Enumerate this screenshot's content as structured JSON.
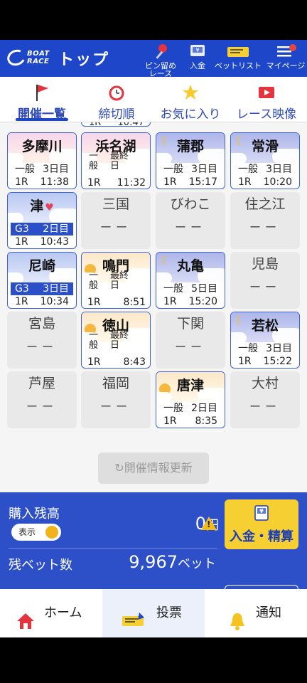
{
  "header": {
    "logo_line1": "BOAT",
    "logo_line2": "RACE",
    "title": "トップ",
    "buttons": [
      {
        "label": "ピン留め\nレース",
        "icon": "pin-icon"
      },
      {
        "label": "入金",
        "icon": "deposit-machine-icon"
      },
      {
        "label": "ベットリスト",
        "icon": "ticket-icon"
      },
      {
        "label": "マイページ",
        "icon": "menu-icon"
      }
    ]
  },
  "tabs": [
    {
      "label": "開催一覧",
      "icon": "flag-icon",
      "active": true
    },
    {
      "label": "締切順",
      "icon": "alarm-clock-icon"
    },
    {
      "label": "お気に入り",
      "icon": "star-icon"
    },
    {
      "label": "レース映像",
      "icon": "video-icon"
    }
  ],
  "venues": [
    {
      "name": "多摩川",
      "state": "open",
      "scene": "dusk",
      "grade": "一般",
      "day": "3日目",
      "race": "1R",
      "time": "11:38"
    },
    {
      "name": "浜名湖",
      "state": "open",
      "scene": "dusk",
      "grade": "一般",
      "day": "最終日",
      "race": "1R",
      "time": "11:32",
      "stacked": true
    },
    {
      "name": "蒲郡",
      "state": "open",
      "scene": "night",
      "grade": "一般",
      "day": "3日目",
      "race": "1R",
      "time": "15:17"
    },
    {
      "name": "常滑",
      "state": "open",
      "scene": "night",
      "grade": "一般",
      "day": "3日目",
      "race": "1R",
      "time": "10:20"
    },
    {
      "name": "津",
      "state": "open",
      "scene": "day",
      "grade": "G3",
      "day": "2日目",
      "race": "1R",
      "time": "10:43",
      "favorite": true
    },
    {
      "name": "三国",
      "state": "closed",
      "dash": "ーー"
    },
    {
      "name": "びわこ",
      "state": "closed",
      "dash": "ーー"
    },
    {
      "name": "住之江",
      "state": "closed",
      "dash": "ーー"
    },
    {
      "name": "尼崎",
      "state": "open",
      "scene": "day",
      "grade": "G3",
      "day": "3日目",
      "race": "1R",
      "time": "10:34"
    },
    {
      "name": "鳴門",
      "state": "open",
      "scene": "morning",
      "grade": "一般",
      "day": "最終日",
      "race": "1R",
      "time": "8:51",
      "stacked": true
    },
    {
      "name": "丸亀",
      "state": "open",
      "scene": "night",
      "grade": "一般",
      "day": "5日目",
      "race": "1R",
      "time": "15:20"
    },
    {
      "name": "児島",
      "state": "closed",
      "dash": "ーー"
    },
    {
      "name": "宮島",
      "state": "closed",
      "dash": "ーー"
    },
    {
      "name": "徳山",
      "state": "open",
      "scene": "morning",
      "grade": "一般",
      "day": "最終日",
      "race": "1R",
      "time": "8:43",
      "stacked": true
    },
    {
      "name": "下関",
      "state": "closed",
      "dash": "ーー"
    },
    {
      "name": "若松",
      "state": "open",
      "scene": "night",
      "grade": "一般",
      "day": "3日目",
      "race": "1R",
      "time": "15:22"
    },
    {
      "name": "芦屋",
      "state": "closed",
      "dash": "ーー"
    },
    {
      "name": "福岡",
      "state": "closed",
      "dash": "ーー"
    },
    {
      "name": "唐津",
      "state": "open",
      "scene": "morning",
      "grade": "一般",
      "day": "2日目",
      "race": "1R",
      "time": "8:35"
    },
    {
      "name": "大村",
      "state": "closed",
      "dash": "ーー"
    }
  ],
  "partial_row": {
    "texts": [
      "1R",
      "10:47"
    ]
  },
  "refresh_label": "開催情報更新",
  "balance_panel": {
    "purchase_balance_label": "購入残高",
    "toggle_label": "表示",
    "balance_value": "0",
    "balance_unit": "円",
    "remaining_bets_label": "残ベット数",
    "remaining_bets_value": "9,967",
    "remaining_bets_unit": "ベット",
    "deposit_button_label": "入金・精算"
  },
  "bottom_nav": [
    {
      "label": "ホーム",
      "icon": "house-icon"
    },
    {
      "label": "投票",
      "icon": "ticket-vote-icon",
      "active": true
    },
    {
      "label": "通知",
      "icon": "bell-icon"
    }
  ],
  "colors": {
    "brand_blue": "#1d46c8",
    "accent_yellow": "#f6cf33",
    "tile_border": "#3e63cf"
  }
}
